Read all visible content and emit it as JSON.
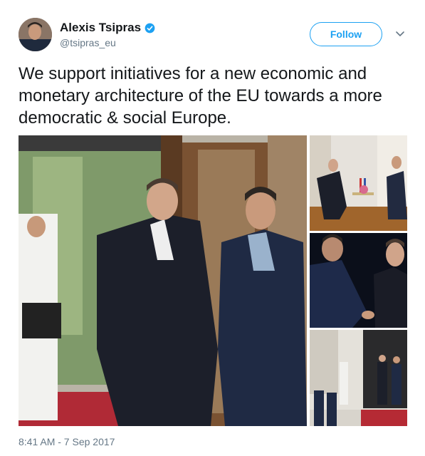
{
  "tweet": {
    "author": {
      "display_name": "Alexis Tsipras",
      "handle": "@tsipras_eu",
      "verified": true,
      "avatar_icon": "profile-photo"
    },
    "follow_label": "Follow",
    "menu_icon": "chevron-down-icon",
    "text": "We support initiatives for a new economic and monetary architecture of the EU towards a more democratic & social Europe.",
    "timestamp": "8:41 AM - 7 Sep 2017",
    "photo_count": 4
  },
  "colors": {
    "accent": "#1da1f2",
    "text": "#14171a",
    "muted": "#657786"
  }
}
